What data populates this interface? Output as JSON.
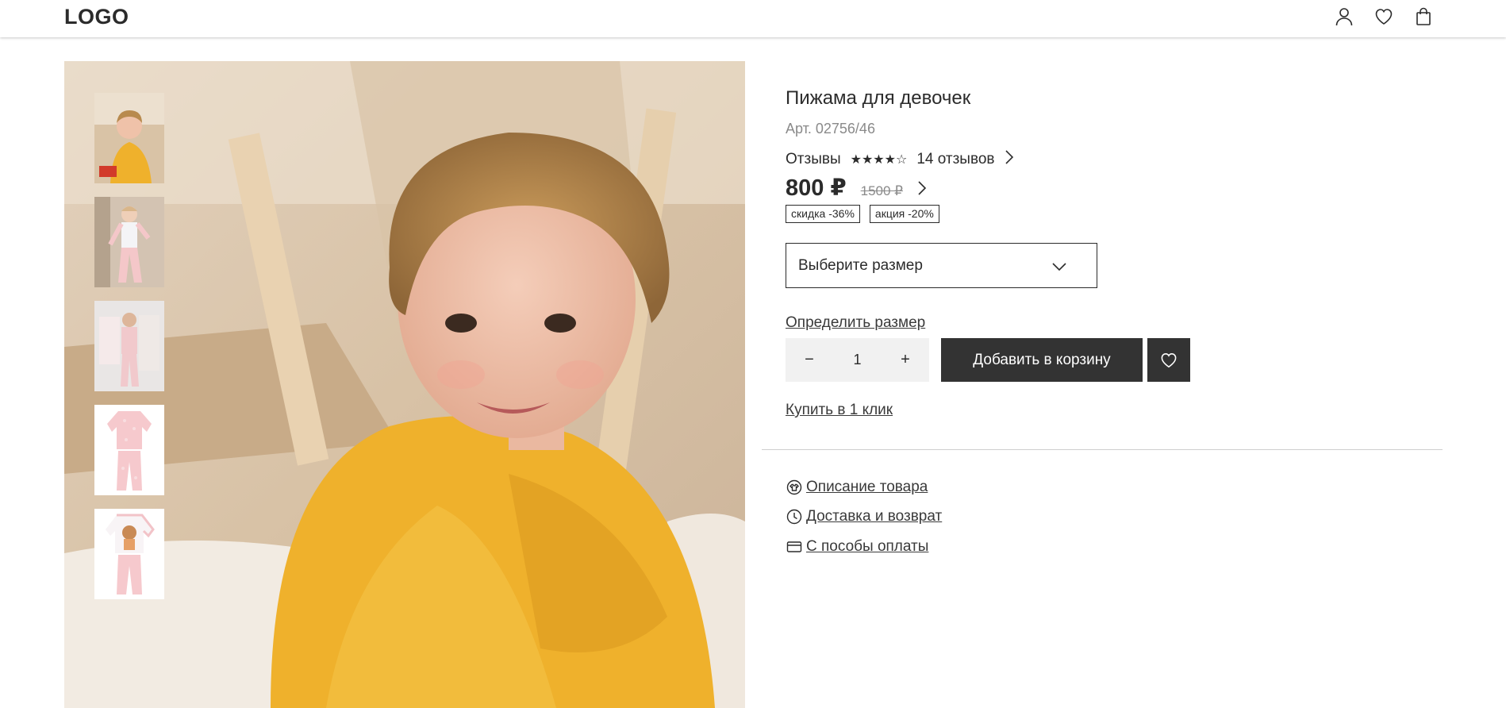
{
  "header": {
    "logo": "LOGO",
    "icons": [
      "user-icon",
      "heart-icon",
      "bag-icon"
    ]
  },
  "product": {
    "title": "Пижама для девочек",
    "sku": "Арт. 02756/46",
    "reviews_label": "Отзывы",
    "stars": "★★★★☆",
    "reviews_count": "14 отзывов",
    "price": "800 ₽",
    "old_price": "1500 ₽",
    "badges": [
      "скидка -36%",
      "акция -20%"
    ],
    "size_placeholder": "Выберите размер",
    "size_link": "Определить размер",
    "quantity": "1",
    "qty_minus": "−",
    "qty_plus": "+",
    "add_to_cart": "Добавить в корзину",
    "one_click": "Купить в 1 клик"
  },
  "info_links": [
    {
      "label": " Описание товара",
      "icon": "tshirt-icon"
    },
    {
      "label": " Доставка и возврат",
      "icon": "clock-icon"
    },
    {
      "label": " С пособы оплаты",
      "icon": "card-icon"
    }
  ],
  "colors": {
    "dark": "#333333",
    "muted": "#8a8a8a",
    "qty_bg": "#f1f1f1"
  }
}
